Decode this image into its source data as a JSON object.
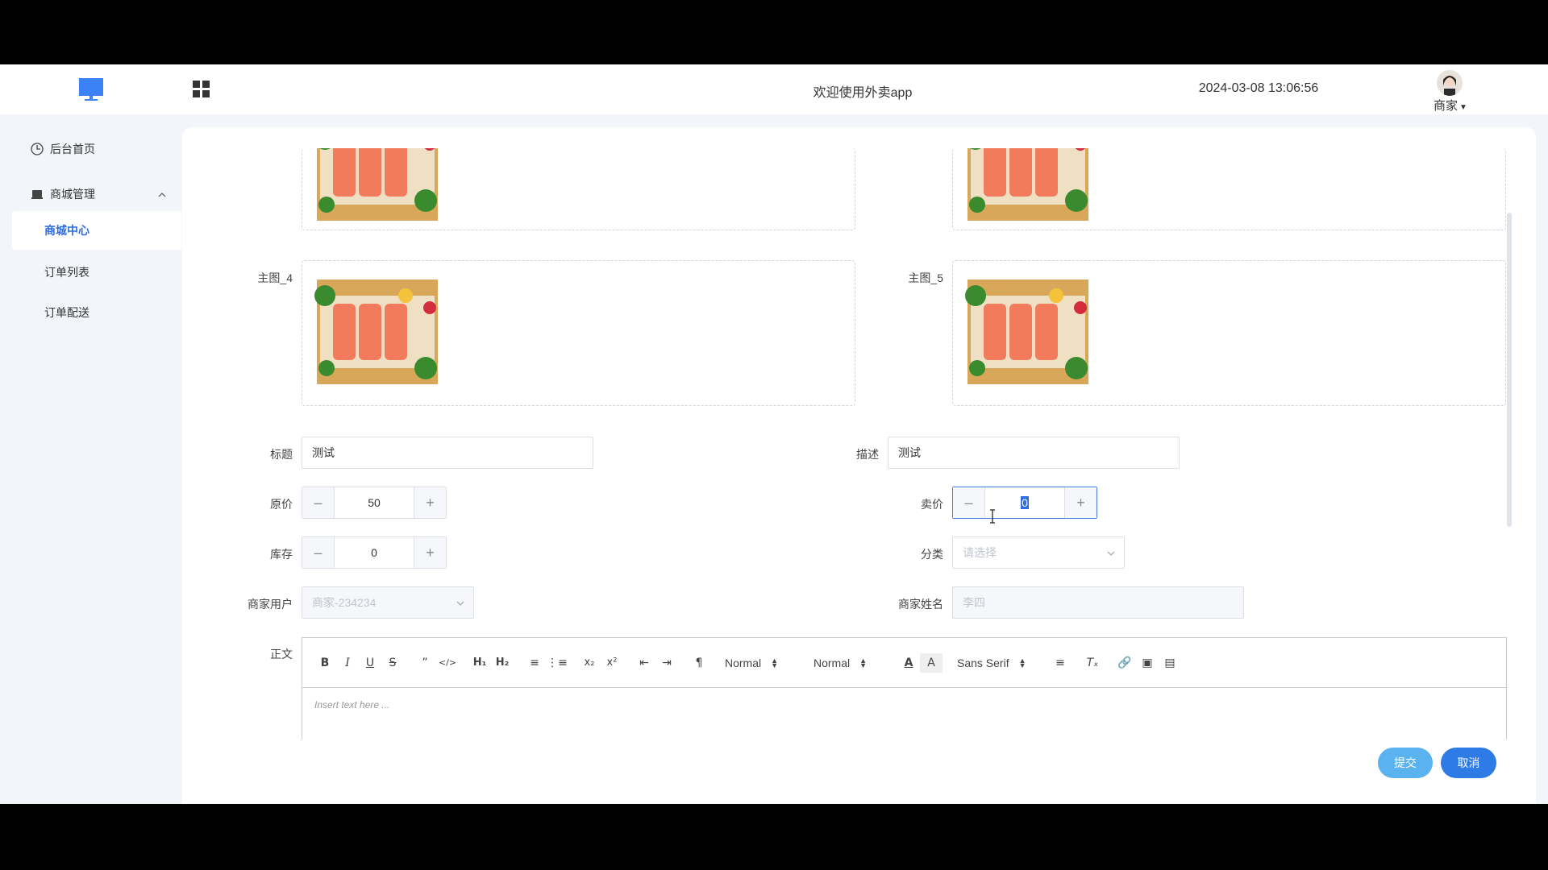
{
  "header": {
    "welcome": "欢迎使用外卖app",
    "datetime": "2024-03-08 13:06:56",
    "user_label": "商家"
  },
  "sidebar": {
    "items": [
      {
        "label": "后台首页",
        "icon": "clock-icon"
      },
      {
        "label": "商城管理",
        "icon": "store-icon"
      }
    ],
    "submenu": [
      {
        "label": "商城中心",
        "active": true
      },
      {
        "label": "订单列表",
        "active": false
      },
      {
        "label": "订单配送",
        "active": false
      }
    ]
  },
  "form": {
    "image4_label": "主图_4",
    "image5_label": "主图_5",
    "title_label": "标题",
    "title_value": "测试",
    "desc_label": "描述",
    "desc_value": "测试",
    "orig_price_label": "原价",
    "orig_price_value": "50",
    "sale_price_label": "卖价",
    "sale_price_value": "0",
    "stock_label": "库存",
    "stock_value": "0",
    "category_label": "分类",
    "category_placeholder": "请选择",
    "merchant_user_label": "商家用户",
    "merchant_user_value": "商家-234234",
    "merchant_name_label": "商家姓名",
    "merchant_name_value": "李四",
    "body_label": "正文",
    "editor_placeholder": "Insert text here ...",
    "header_picker": "Normal",
    "size_picker": "Normal",
    "font_picker": "Sans Serif"
  },
  "actions": {
    "submit": "提交",
    "cancel": "取消"
  },
  "colors": {
    "accent": "#2f6ce0",
    "submit_bg": "#5ab3ee",
    "cancel_bg": "#2f7be6"
  }
}
